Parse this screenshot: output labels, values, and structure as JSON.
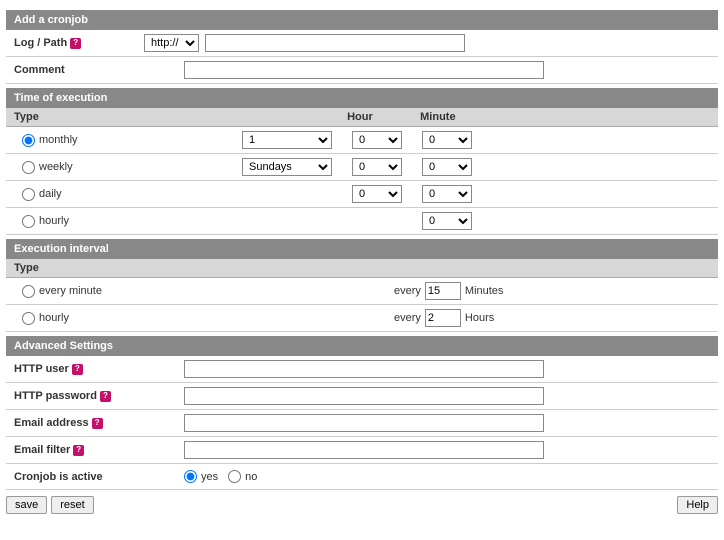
{
  "sections": {
    "add": "Add a cronjob",
    "time": "Time of execution",
    "interval": "Execution interval",
    "advanced": "Advanced Settings"
  },
  "add": {
    "log_path_label": "Log / Path",
    "protocol": "http://",
    "path_value": "",
    "comment_label": "Comment",
    "comment_value": ""
  },
  "time_headers": {
    "type": "Type",
    "hour": "Hour",
    "minute": "Minute"
  },
  "time_rows": {
    "monthly": {
      "label": "monthly",
      "day": "1",
      "hour": "0",
      "minute": "0",
      "checked": true
    },
    "weekly": {
      "label": "weekly",
      "day": "Sundays",
      "hour": "0",
      "minute": "0",
      "checked": false
    },
    "daily": {
      "label": "daily",
      "hour": "0",
      "minute": "0",
      "checked": false
    },
    "hourly": {
      "label": "hourly",
      "minute": "0",
      "checked": false
    }
  },
  "interval_header": "Type",
  "interval_rows": {
    "minute": {
      "label": "every minute",
      "prefix": "every",
      "value": "15",
      "unit": "Minutes"
    },
    "hour": {
      "label": "hourly",
      "prefix": "every",
      "value": "2",
      "unit": "Hours"
    }
  },
  "advanced": {
    "http_user": "HTTP user",
    "http_password": "HTTP password",
    "email_address": "Email address",
    "email_filter": "Email filter",
    "active_label": "Cronjob is active",
    "yes": "yes",
    "no": "no"
  },
  "buttons": {
    "save": "save",
    "reset": "reset",
    "help": "Help"
  }
}
